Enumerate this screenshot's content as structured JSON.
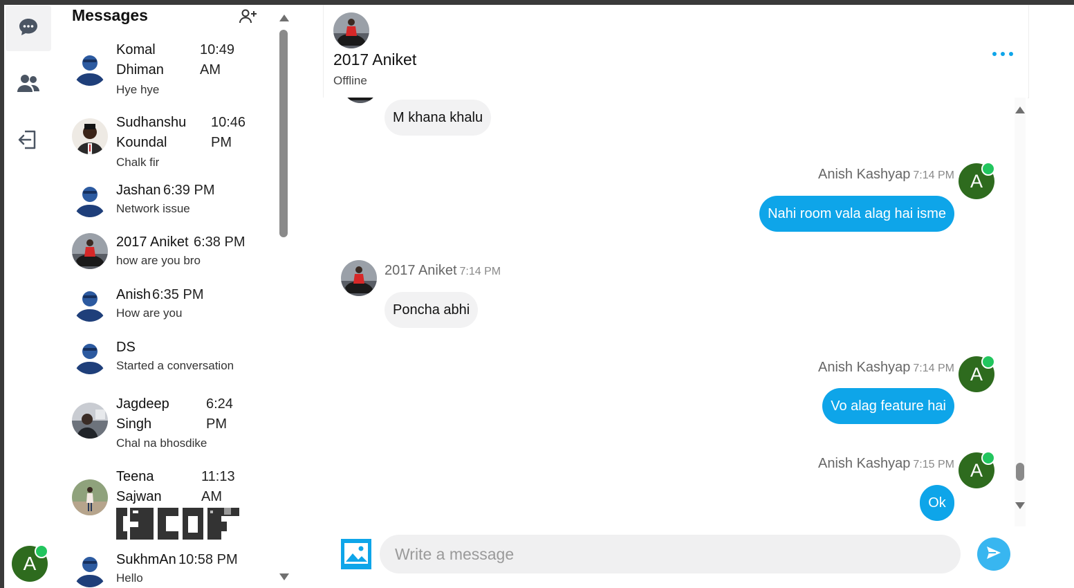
{
  "sidebar": {
    "nav": [
      {
        "icon": "chat-bubble-icon",
        "active": true
      },
      {
        "icon": "users-icon",
        "active": false
      },
      {
        "icon": "logout-icon",
        "active": false
      }
    ],
    "user_initial": "A"
  },
  "list": {
    "title": "Messages",
    "new_chat_icon": "add-user-icon",
    "conversations": [
      {
        "name": "Komal Dhiman",
        "time": "10:49 AM",
        "preview": "Hye hye",
        "avatar": "default-avatar-icon"
      },
      {
        "name": "Sudhanshu Koundal",
        "time": "10:46 PM",
        "preview": "Chalk fir",
        "avatar": "photo-avatar"
      },
      {
        "name": "Jashan",
        "time": "6:39 PM",
        "preview": "Network issue",
        "avatar": "default-avatar-icon"
      },
      {
        "name": "2017 Aniket",
        "time": "6:38 PM",
        "preview": "how are you bro",
        "avatar": "photo-avatar"
      },
      {
        "name": "Anish",
        "time": "6:35 PM",
        "preview": "How are you",
        "avatar": "default-avatar-icon"
      },
      {
        "name": "DS",
        "time": "",
        "preview": "Started a conversation",
        "avatar": "default-avatar-icon"
      },
      {
        "name": "Jagdeep Singh",
        "time": "6:24 PM",
        "preview": "Chal na bhosdike",
        "avatar": "photo-avatar"
      },
      {
        "name": "Teena Sajwan",
        "time": "11:13 AM",
        "preview": "",
        "avatar": "photo-avatar"
      },
      {
        "name": "SukhmAn",
        "time": "10:58 PM",
        "preview": "Hello",
        "avatar": "default-avatar-icon"
      }
    ]
  },
  "chat": {
    "contact_name": "2017 Aniket",
    "status": "Offline",
    "more_icon": "more-horizontal-icon",
    "messages": [
      {
        "dir": "in",
        "sender": "",
        "time": "",
        "text": "M khana khalu"
      },
      {
        "dir": "out",
        "sender": "Anish Kashyap",
        "time": "7:14 PM",
        "text": "Nahi room vala alag hai isme",
        "initial": "A"
      },
      {
        "dir": "in",
        "sender": "2017 Aniket",
        "time": "7:14 PM",
        "text": "Poncha abhi"
      },
      {
        "dir": "out",
        "sender": "Anish Kashyap",
        "time": "7:14 PM",
        "text": "Vo alag feature hai",
        "initial": "A"
      },
      {
        "dir": "out",
        "sender": "Anish Kashyap",
        "time": "7:15 PM",
        "text": "Ok",
        "initial": "A"
      }
    ],
    "composer": {
      "placeholder": "Write a message",
      "image_icon": "image-upload-icon",
      "send_icon": "send-icon"
    }
  },
  "colors": {
    "accent": "#0ea5e9",
    "online": "#22c55e",
    "user_avatar": "#2e6b1e",
    "incoming_bubble": "#f2f2f3"
  }
}
